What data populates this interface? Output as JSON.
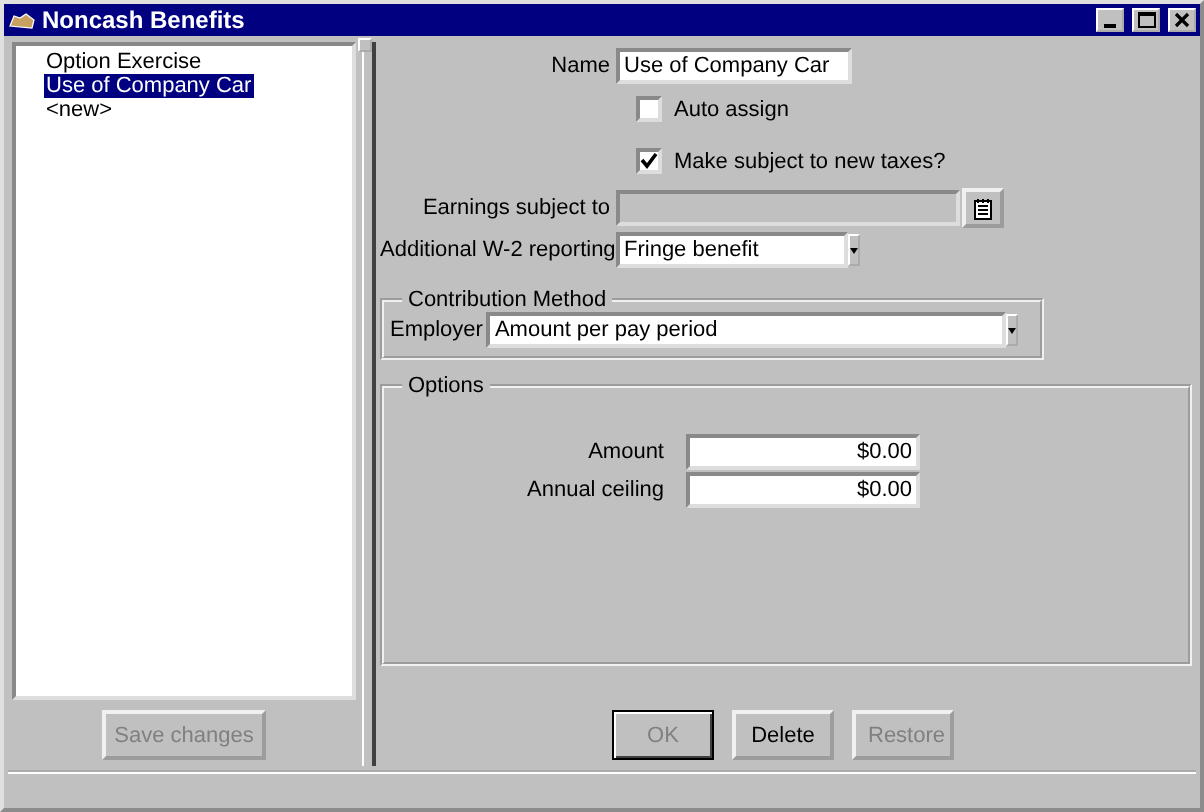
{
  "window": {
    "title": "Noncash Benefits"
  },
  "list": {
    "items": [
      {
        "label": "Option Exercise",
        "selected": false
      },
      {
        "label": "Use of Company Car",
        "selected": true
      },
      {
        "label": "<new>",
        "selected": false
      }
    ]
  },
  "save_button": {
    "label": "Save changes",
    "disabled": true
  },
  "form": {
    "name": {
      "label": "Name",
      "value": "Use of Company Car"
    },
    "auto_assign": {
      "label": "Auto assign",
      "checked": false
    },
    "subject_to_taxes": {
      "label": "Make subject to new taxes?",
      "checked": true
    },
    "earnings_subject_to": {
      "label": "Earnings subject to",
      "disabled": true
    },
    "w2_reporting": {
      "label": "Additional W-2 reporting",
      "value": "Fringe benefit"
    },
    "contribution_method": {
      "title": "Contribution Method",
      "employer": {
        "label": "Employer",
        "value": "Amount per pay period"
      }
    },
    "options": {
      "title": "Options",
      "fields": [
        {
          "label": "Amount",
          "value": "$0.00"
        },
        {
          "label": "Annual ceiling",
          "value": "$0.00"
        }
      ]
    }
  },
  "buttons": [
    {
      "label": "OK",
      "disabled": true
    },
    {
      "label": "Delete",
      "disabled": false
    },
    {
      "label": "Restore",
      "disabled": true
    }
  ]
}
